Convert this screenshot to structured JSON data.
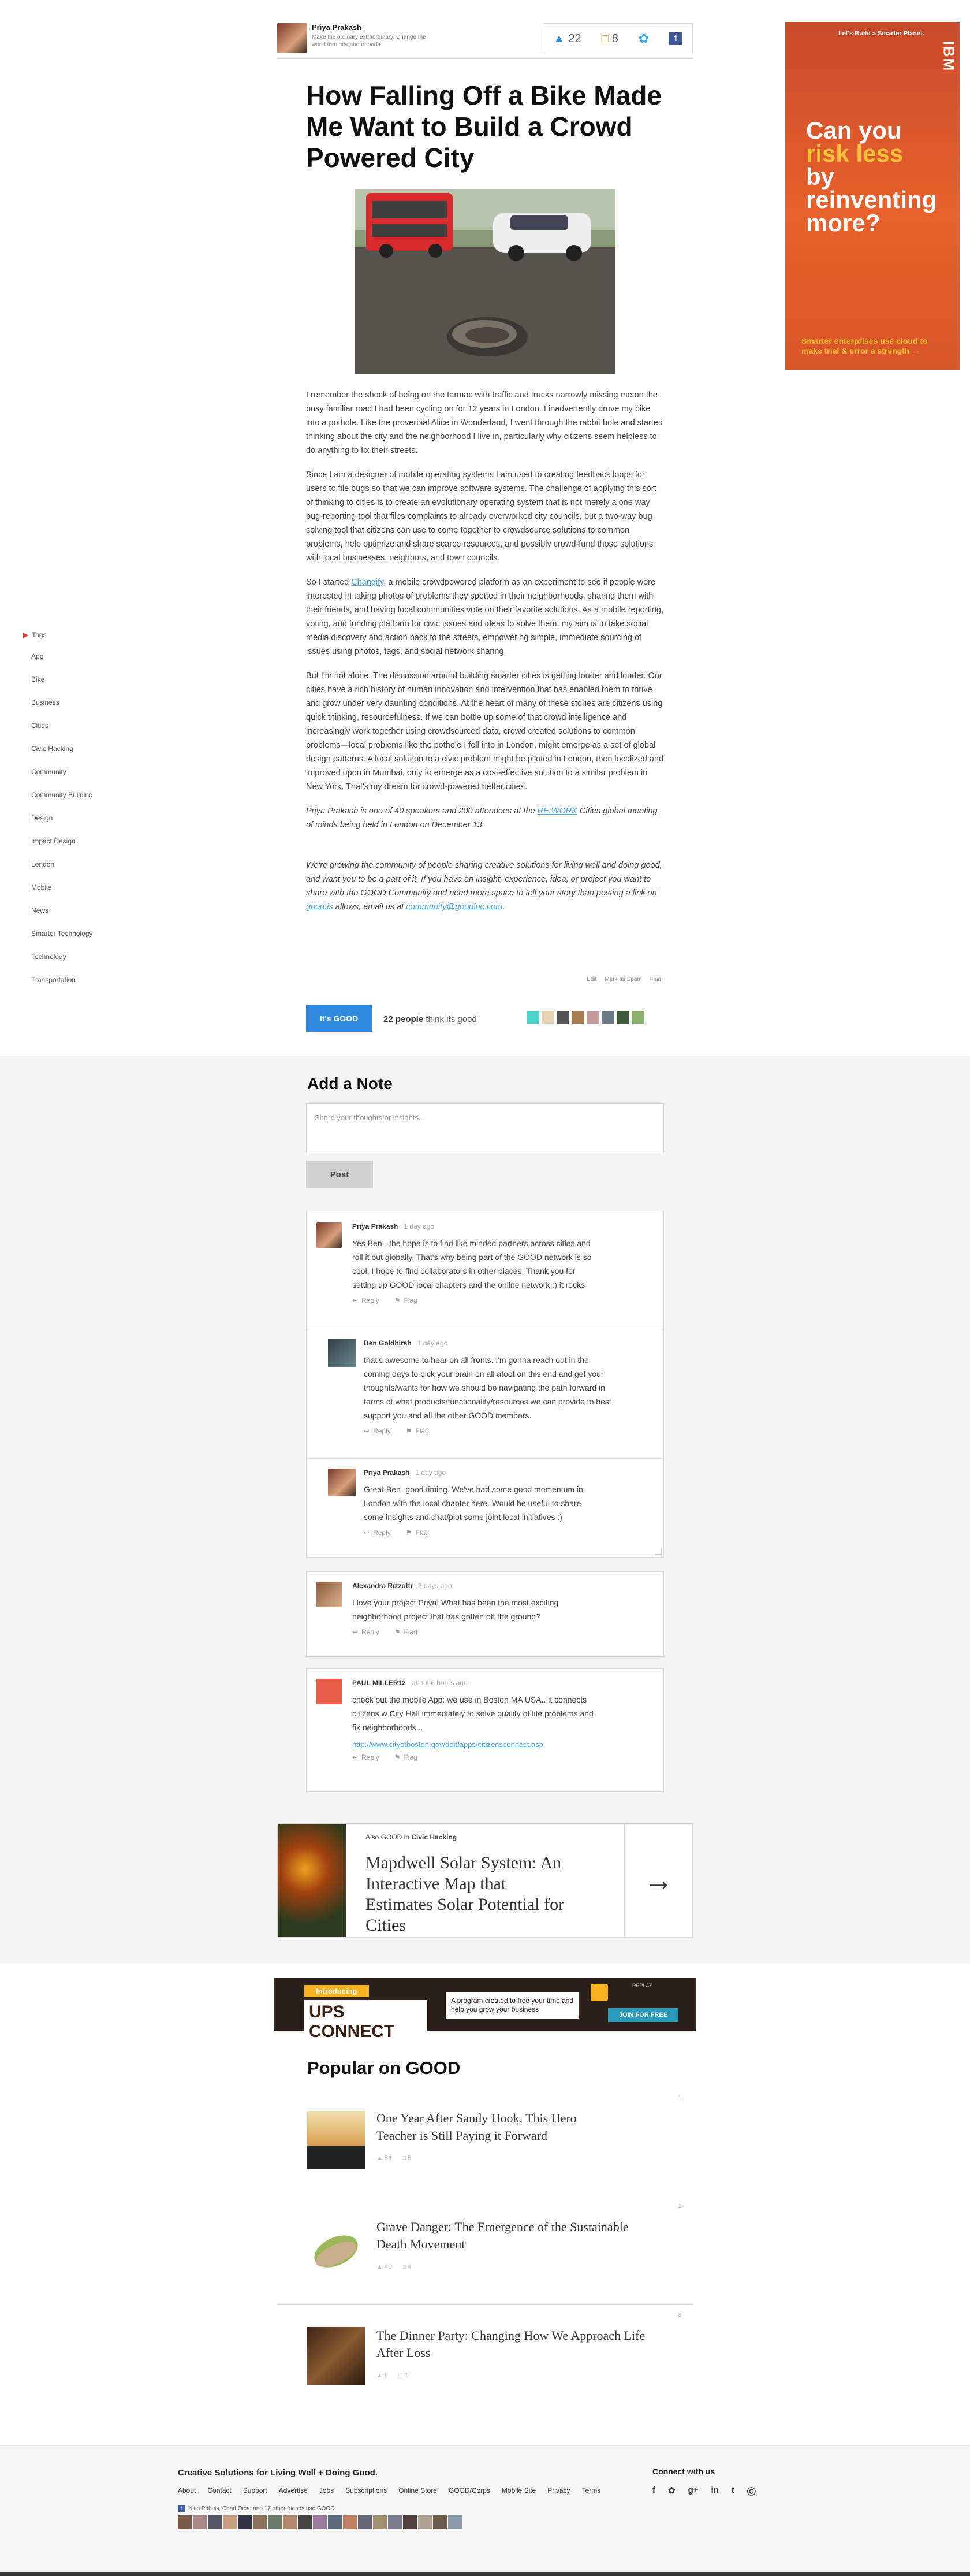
{
  "author": {
    "name": "Priya Prakash",
    "bio": "Make the ordinary extraordinary. Change the world thru neighbourhoods."
  },
  "shares": {
    "good_count": "22",
    "comments_count": "8"
  },
  "article": {
    "title": "How Falling Off a Bike Made Me Want to Build a Crowd Powered City",
    "p1": "I remember the shock of being on the tarmac with traffic and trucks narrowly missing me on the busy familiar road I had been cycling on for 12 years in London. I inadvertently drove my bike into a pothole. Like the proverbial Alice in Wonderland, I went through the rabbit hole and started thinking about the city and the neighborhood I live in, particularly why citizens seem helpless to do anything to fix their streets.",
    "p2": "Since I am a designer of mobile operating systems I am used to creating feedback loops for users to file bugs so that we can improve software systems. The challenge of applying this sort of thinking to cities is to create an evolutionary operating system that is not merely a one way bug-reporting tool that files complaints to already overworked city councils, but a two-way bug solving tool that citizens can use to come together to crowdsource solutions to common problems, help optimize and share scarce resources, and possibly crowd-fund those solutions with local businesses, neighbors, and town councils.",
    "p3_pre": "So I started ",
    "p3_link": "Changify",
    "p3_post": ", a mobile crowdpowered platform as an experiment to see if people were interested in taking photos of problems they spotted in their neighborhoods, sharing them with their friends, and having local communities vote on their favorite solutions. As a mobile reporting, voting, and funding platform for civic issues and ideas to solve them, my aim is to take social media discovery and action back to the streets, empowering simple, immediate sourcing of issues using photos, tags, and social network sharing.",
    "p4": "But I'm not alone. The discussion around building smarter cities is getting louder and louder. Our cities have a rich history of human innovation and intervention that has enabled them to thrive and grow under very daunting conditions. At the heart of many of these stories are citizens using quick thinking, resourcefulness. If we can bottle up some of that crowd intelligence and increasingly work together using crowdsourced data, crowd created solutions to common problems—local problems like the pothole I fell into in London, might emerge as a set of global design patterns. A local solution to a civic problem might be piloted in London, then localized and improved upon in Mumbai, only to emerge as a cost-effective solution to a similar problem in New York. That's my dream for crowd-powered better cities.",
    "p5_pre": "Priya Prakash is one of 40 speakers and 200 attendees at the ",
    "p5_link": "RE:WORK",
    "p5_post": " Cities global meeting of minds being held in London on December 13.",
    "p6_pre": "We're growing the community of people sharing creative solutions for living well and doing good, and want you to be a part of it. If you have an insight, experience, idea, or project you want to share with the GOOD Community and need more space to tell your story than posting a link on ",
    "p6_link1": "good.is",
    "p6_mid": " allows, email us at ",
    "p6_link2": "community@goodinc.com",
    "p6_end": "."
  },
  "article_actions": {
    "edit": "Edit",
    "spam": "Mark as Spam",
    "flag": "Flag"
  },
  "good_bar": {
    "button": "It's GOOD",
    "count": "22 people",
    "suffix": "think its good"
  },
  "tags": {
    "header": "Tags",
    "items": [
      "App",
      "Bike",
      "Business",
      "Cities",
      "Civic Hacking",
      "Community",
      "Community Building",
      "Design",
      "Impact Design",
      "London",
      "Mobile",
      "News",
      "Smarter Technology",
      "Technology",
      "Transportation"
    ]
  },
  "notes": {
    "title": "Add a Note",
    "placeholder": "Share your thoughts or insights...",
    "post": "Post",
    "reply": "Reply",
    "flag": "Flag"
  },
  "comments": [
    {
      "name": "Priya Prakash",
      "time": "1 day ago",
      "text": "Yes Ben - the hope is to find like minded partners across cities and roll it out globally. That's why being part of the GOOD network is so cool, I hope to find collaborators in other places. Thank you for setting up GOOD local chapters and the online network :) it rocks"
    },
    {
      "name": "Ben Goldhirsh",
      "time": "1 day ago",
      "text": "that's awesome to hear on all fronts. I'm gonna reach out in the coming days to pick your brain on all afoot on this end and get your thoughts/wants for how we should be navigating the path forward in terms of what products/functionality/resources we can provide to best support you and all the other GOOD members."
    },
    {
      "name": "Priya Prakash",
      "time": "1 day ago",
      "text": "Great Ben- good timing. We've had some good momentum in London with the local chapter here. Would be useful to share some insights and chat/plot some joint local initiatives :)"
    },
    {
      "name": "Alexandra Rizzotti",
      "time": "3 days ago",
      "text": "I love your project Priya! What has been the most exciting neighborhood project that has gotten off the ground?"
    },
    {
      "name": "PAUL MILLER12",
      "time": "about 6 hours ago",
      "text": "check out the mobile App: we use in Boston MA USA.. it connects citizens w City Hall immediately to solve quality of life problems and fix neighborhoods...",
      "link": "http://www.cityofboston.gov/doit/apps/citizensconnect.asp"
    }
  ],
  "also_good": {
    "prefix": "Also GOOD in",
    "category": "Civic Hacking",
    "title": "Mapdwell Solar System: An Interactive Map that Estimates Solar Potential for Cities"
  },
  "ups_ad": {
    "badge": "Introducing",
    "brand": "UPS CONNECT",
    "copy": "A program created to free your time and help you grow your business",
    "cta": "JOIN FOR FREE",
    "replay": "REPLAY"
  },
  "popular": {
    "title": "Popular on GOOD",
    "items": [
      {
        "num": "1",
        "title": "One Year After Sandy Hook, This Hero Teacher is Still Paying it Forward",
        "goods": "56",
        "comments": "5"
      },
      {
        "num": "2",
        "title": "Grave Danger: The Emergence of the Sustainable Death Movement",
        "goods": "41",
        "comments": "4"
      },
      {
        "num": "3",
        "title": "The Dinner Party: Changing How We Approach Life After Loss",
        "goods": "8",
        "comments": "2"
      }
    ]
  },
  "footer": {
    "tagline": "Creative Solutions for Living Well + Doing Good.",
    "links": [
      "About",
      "Contact",
      "Support",
      "Advertise",
      "Jobs",
      "Subscriptions",
      "Online Store",
      "GOOD/Corps",
      "Mobile Site",
      "Privacy",
      "Terms"
    ],
    "connect": "Connect with us",
    "friends": "Nitin Pabuis, Chad Oeso and 17 other friends use GOOD."
  },
  "ibm_ad": {
    "top": "Let's Build a Smarter Planet.",
    "line1": "Can you",
    "line2": "risk less",
    "line3": "by reinventing more?",
    "bottom": "Smarter enterprises use cloud to make trial & error a strength →",
    "logo": "IBM"
  }
}
